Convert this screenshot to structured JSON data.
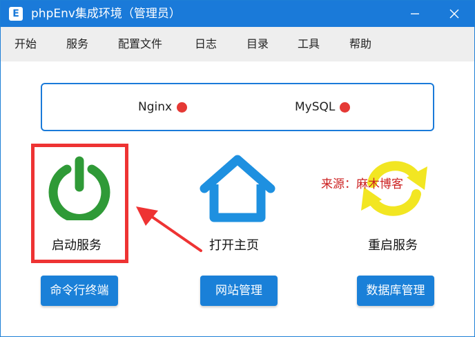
{
  "window": {
    "title": "phpEnv集成环境（管理员）",
    "app_icon_letter": "E"
  },
  "menu": {
    "items": [
      "开始",
      "服务",
      "配置文件",
      "日志",
      "目录",
      "工具",
      "帮助"
    ]
  },
  "services": [
    {
      "name": "Nginx",
      "status_color": "#e53935"
    },
    {
      "name": "MySQL",
      "status_color": "#e53935"
    }
  ],
  "tiles": {
    "start": {
      "label": "启动服务",
      "icon": "power-icon",
      "color": "#2f9a37"
    },
    "home": {
      "label": "打开主页",
      "icon": "home-icon",
      "color": "#1e90e0"
    },
    "restart": {
      "label": "重启服务",
      "icon": "refresh-icon",
      "color": "#f2e622"
    }
  },
  "buttons": {
    "cmd": "命令行终端",
    "site": "网站管理",
    "db": "数据库管理"
  },
  "watermark": "来源：麻木博客",
  "colors": {
    "accent": "#1a7ad9",
    "annotation": "#ee3333"
  }
}
